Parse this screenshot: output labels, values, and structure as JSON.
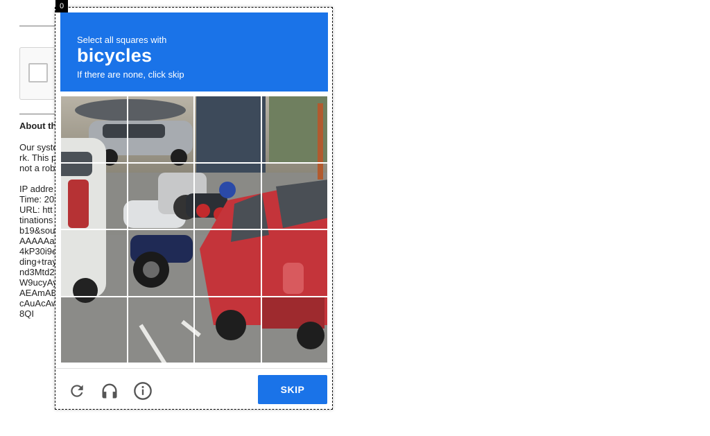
{
  "background": {
    "heading": "About th",
    "paragraph": [
      "Our syste",
      "rk. This p",
      "not a rob"
    ],
    "details": [
      "IP addre",
      "Time: 20",
      "URL: htt",
      "tinations",
      "b19&sou",
      "AAAAAa",
      "4kP30i9e",
      "ding+tray",
      "nd3Mtd2",
      "W9ucyAy",
      "AEAmAB",
      "cAuAcAw",
      "8QI"
    ]
  },
  "popup": {
    "focus_badge": "0",
    "instruction": "Select all squares with",
    "target": "bicycles",
    "hint": "If there are none, click skip",
    "grid_image": "street-with-motorcycles-and-red-car",
    "grid_size": 4,
    "footer": {
      "reload_icon": "reload-icon",
      "audio_icon": "headphones-icon",
      "info_icon": "info-icon",
      "skip_label": "SKIP"
    }
  },
  "colors": {
    "accent": "#1a73e8",
    "banner_text": "#ffffff",
    "icon_gray": "#555555"
  }
}
